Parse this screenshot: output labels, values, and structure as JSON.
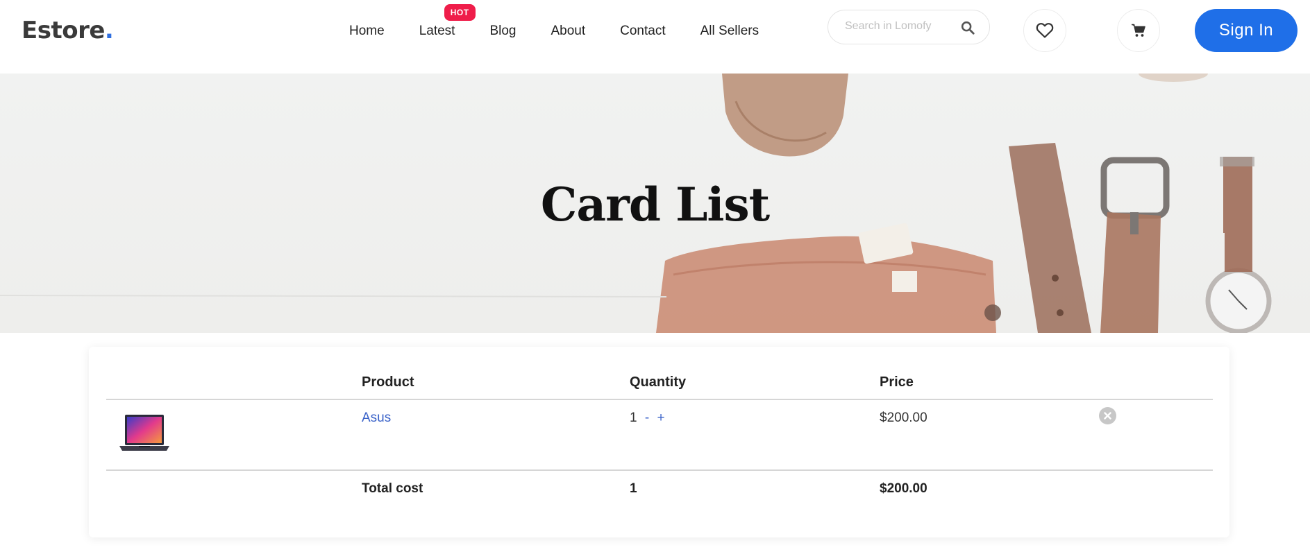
{
  "brand": {
    "name": "Estore",
    "dot": ".",
    "dot_color": "#2f6fe0"
  },
  "nav": {
    "items": [
      {
        "label": "Home"
      },
      {
        "label": "Latest",
        "badge": "HOT"
      },
      {
        "label": "Blog"
      },
      {
        "label": "About"
      },
      {
        "label": "Contact"
      },
      {
        "label": "All Sellers"
      }
    ]
  },
  "search": {
    "placeholder": "Search in Lomofy",
    "icon": "search-icon"
  },
  "actions": {
    "wishlist_icon": "heart-icon",
    "cart_icon": "cart-icon",
    "signin_label": "Sign In"
  },
  "hero": {
    "title": "Card List"
  },
  "cart_table": {
    "headers": {
      "product": "Product",
      "quantity": "Quantity",
      "price": "Price"
    },
    "rows": [
      {
        "product": "Asus",
        "quantity": "1",
        "minus": "-",
        "plus": "+",
        "price": "$200.00"
      }
    ],
    "total": {
      "label": "Total cost",
      "quantity": "1",
      "price": "$200.00"
    }
  },
  "colors": {
    "accent": "#1f6fe8",
    "badge": "#ef1d4a",
    "link": "#3b63c9"
  }
}
